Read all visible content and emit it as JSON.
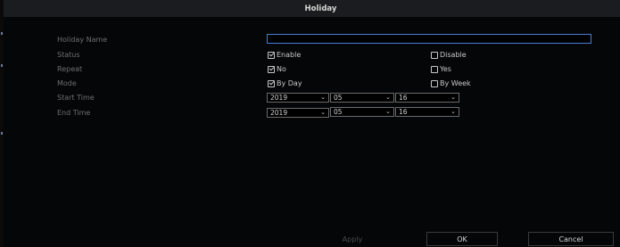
{
  "dialog": {
    "title": "Holiday"
  },
  "form": {
    "holiday_name": {
      "label": "Holiday Name",
      "value": ""
    },
    "status": {
      "label": "Status",
      "options": [
        "Enable",
        "Disable"
      ],
      "selected": "Enable"
    },
    "repeat": {
      "label": "Repeat",
      "options": [
        "No",
        "Yes"
      ],
      "selected": "No"
    },
    "mode": {
      "label": "Mode",
      "options": [
        "By Day",
        "By Week"
      ],
      "selected": "By Day"
    },
    "start_time": {
      "label": "Start Time",
      "year": "2019",
      "month": "05",
      "day": "16"
    },
    "end_time": {
      "label": "End Time",
      "year": "2019",
      "month": "05",
      "day": "16"
    }
  },
  "icons": {
    "dropdown": "chevron-down-icon",
    "checkbox": "checkbox-icon"
  },
  "caret": "⌄",
  "buttons": {
    "apply": "Apply",
    "ok": "OK",
    "cancel": "Cancel"
  },
  "colors": {
    "accent": "#4a7bd6",
    "title_bar": "#1b1c1f",
    "background": "#050607"
  }
}
